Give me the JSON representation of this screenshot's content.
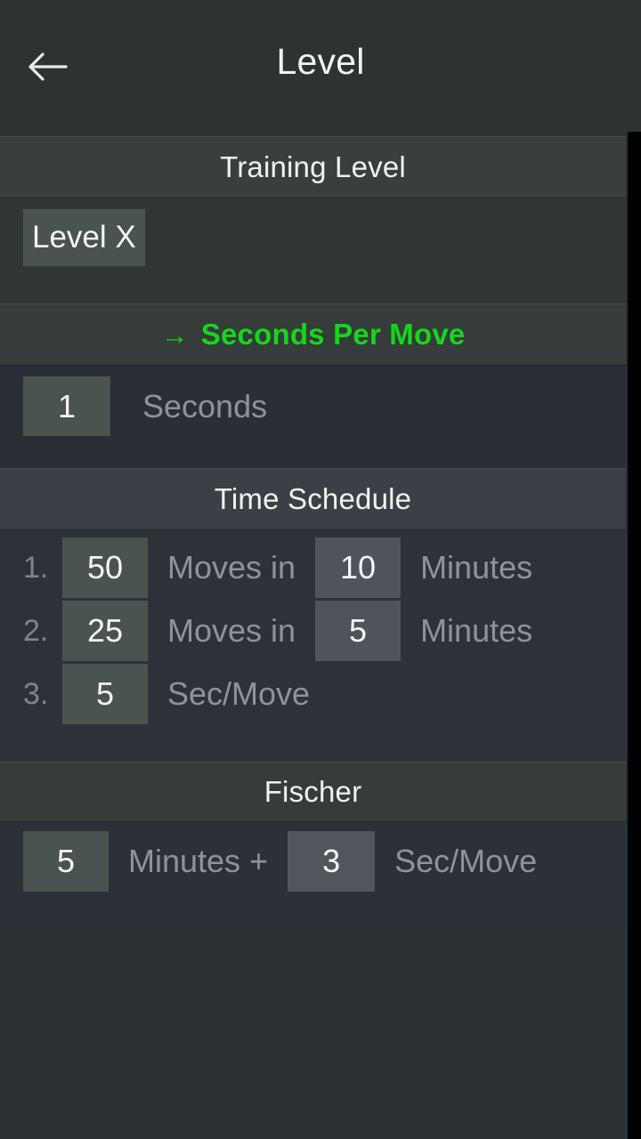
{
  "appbar": {
    "back_icon": "arrow-left-icon",
    "title": "Level"
  },
  "sections": {
    "training_level": {
      "header": "Training Level",
      "level_button": "Level X"
    },
    "seconds_per_move": {
      "arrow_glyph": "→",
      "header": "Seconds Per Move",
      "active": true,
      "accent_color": "#16d61c",
      "value": "1",
      "unit_label": "Seconds"
    },
    "time_schedule": {
      "header": "Time Schedule",
      "rows": [
        {
          "index": "1.",
          "moves": "50",
          "mid_label": "Moves in",
          "minutes": "10",
          "tail_label": "Minutes"
        },
        {
          "index": "2.",
          "moves": "25",
          "mid_label": "Moves in",
          "minutes": "5",
          "tail_label": "Minutes"
        },
        {
          "index": "3.",
          "moves": "5",
          "mid_label": "Sec/Move",
          "minutes": "",
          "tail_label": ""
        }
      ]
    },
    "fischer": {
      "header": "Fischer",
      "minutes": "5",
      "mid_label": "Minutes +",
      "increment": "3",
      "tail_label": "Sec/Move"
    }
  },
  "colors": {
    "accent_green": "#16d61c",
    "page_bg": "#2b3035",
    "appbar_bg": "#2c3330",
    "header_band": "#383f3c",
    "value_box": "#4b5350",
    "label_grey": "#8d9499"
  }
}
